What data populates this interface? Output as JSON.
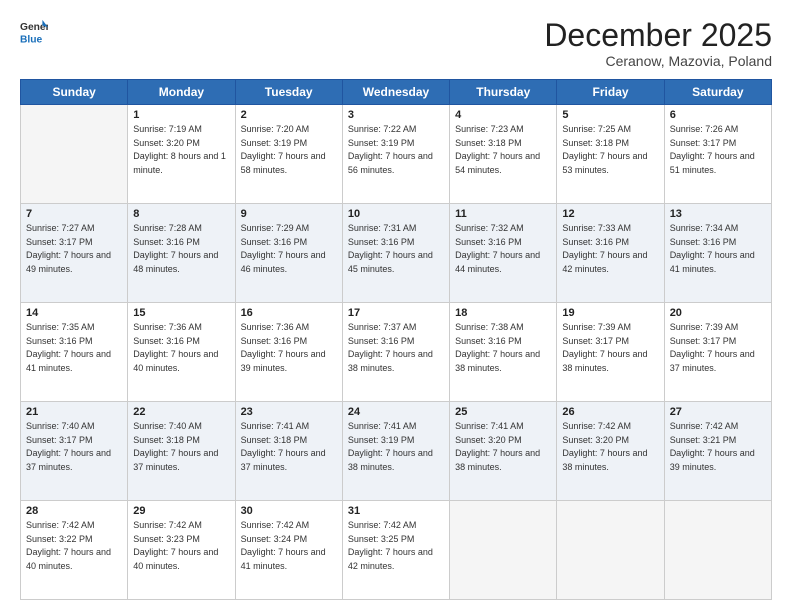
{
  "header": {
    "logo_line1": "General",
    "logo_line2": "Blue",
    "month": "December 2025",
    "location": "Ceranow, Mazovia, Poland"
  },
  "days_of_week": [
    "Sunday",
    "Monday",
    "Tuesday",
    "Wednesday",
    "Thursday",
    "Friday",
    "Saturday"
  ],
  "weeks": [
    [
      {
        "day": "",
        "empty": true
      },
      {
        "day": "1",
        "sunrise": "7:19 AM",
        "sunset": "3:20 PM",
        "daylight": "8 hours and 1 minute."
      },
      {
        "day": "2",
        "sunrise": "7:20 AM",
        "sunset": "3:19 PM",
        "daylight": "7 hours and 58 minutes."
      },
      {
        "day": "3",
        "sunrise": "7:22 AM",
        "sunset": "3:19 PM",
        "daylight": "7 hours and 56 minutes."
      },
      {
        "day": "4",
        "sunrise": "7:23 AM",
        "sunset": "3:18 PM",
        "daylight": "7 hours and 54 minutes."
      },
      {
        "day": "5",
        "sunrise": "7:25 AM",
        "sunset": "3:18 PM",
        "daylight": "7 hours and 53 minutes."
      },
      {
        "day": "6",
        "sunrise": "7:26 AM",
        "sunset": "3:17 PM",
        "daylight": "7 hours and 51 minutes."
      }
    ],
    [
      {
        "day": "7",
        "sunrise": "7:27 AM",
        "sunset": "3:17 PM",
        "daylight": "7 hours and 49 minutes."
      },
      {
        "day": "8",
        "sunrise": "7:28 AM",
        "sunset": "3:16 PM",
        "daylight": "7 hours and 48 minutes."
      },
      {
        "day": "9",
        "sunrise": "7:29 AM",
        "sunset": "3:16 PM",
        "daylight": "7 hours and 46 minutes."
      },
      {
        "day": "10",
        "sunrise": "7:31 AM",
        "sunset": "3:16 PM",
        "daylight": "7 hours and 45 minutes."
      },
      {
        "day": "11",
        "sunrise": "7:32 AM",
        "sunset": "3:16 PM",
        "daylight": "7 hours and 44 minutes."
      },
      {
        "day": "12",
        "sunrise": "7:33 AM",
        "sunset": "3:16 PM",
        "daylight": "7 hours and 42 minutes."
      },
      {
        "day": "13",
        "sunrise": "7:34 AM",
        "sunset": "3:16 PM",
        "daylight": "7 hours and 41 minutes."
      }
    ],
    [
      {
        "day": "14",
        "sunrise": "7:35 AM",
        "sunset": "3:16 PM",
        "daylight": "7 hours and 41 minutes."
      },
      {
        "day": "15",
        "sunrise": "7:36 AM",
        "sunset": "3:16 PM",
        "daylight": "7 hours and 40 minutes."
      },
      {
        "day": "16",
        "sunrise": "7:36 AM",
        "sunset": "3:16 PM",
        "daylight": "7 hours and 39 minutes."
      },
      {
        "day": "17",
        "sunrise": "7:37 AM",
        "sunset": "3:16 PM",
        "daylight": "7 hours and 38 minutes."
      },
      {
        "day": "18",
        "sunrise": "7:38 AM",
        "sunset": "3:16 PM",
        "daylight": "7 hours and 38 minutes."
      },
      {
        "day": "19",
        "sunrise": "7:39 AM",
        "sunset": "3:17 PM",
        "daylight": "7 hours and 38 minutes."
      },
      {
        "day": "20",
        "sunrise": "7:39 AM",
        "sunset": "3:17 PM",
        "daylight": "7 hours and 37 minutes."
      }
    ],
    [
      {
        "day": "21",
        "sunrise": "7:40 AM",
        "sunset": "3:17 PM",
        "daylight": "7 hours and 37 minutes."
      },
      {
        "day": "22",
        "sunrise": "7:40 AM",
        "sunset": "3:18 PM",
        "daylight": "7 hours and 37 minutes."
      },
      {
        "day": "23",
        "sunrise": "7:41 AM",
        "sunset": "3:18 PM",
        "daylight": "7 hours and 37 minutes."
      },
      {
        "day": "24",
        "sunrise": "7:41 AM",
        "sunset": "3:19 PM",
        "daylight": "7 hours and 38 minutes."
      },
      {
        "day": "25",
        "sunrise": "7:41 AM",
        "sunset": "3:20 PM",
        "daylight": "7 hours and 38 minutes."
      },
      {
        "day": "26",
        "sunrise": "7:42 AM",
        "sunset": "3:20 PM",
        "daylight": "7 hours and 38 minutes."
      },
      {
        "day": "27",
        "sunrise": "7:42 AM",
        "sunset": "3:21 PM",
        "daylight": "7 hours and 39 minutes."
      }
    ],
    [
      {
        "day": "28",
        "sunrise": "7:42 AM",
        "sunset": "3:22 PM",
        "daylight": "7 hours and 40 minutes."
      },
      {
        "day": "29",
        "sunrise": "7:42 AM",
        "sunset": "3:23 PM",
        "daylight": "7 hours and 40 minutes."
      },
      {
        "day": "30",
        "sunrise": "7:42 AM",
        "sunset": "3:24 PM",
        "daylight": "7 hours and 41 minutes."
      },
      {
        "day": "31",
        "sunrise": "7:42 AM",
        "sunset": "3:25 PM",
        "daylight": "7 hours and 42 minutes."
      },
      {
        "day": "",
        "empty": true
      },
      {
        "day": "",
        "empty": true
      },
      {
        "day": "",
        "empty": true
      }
    ]
  ]
}
